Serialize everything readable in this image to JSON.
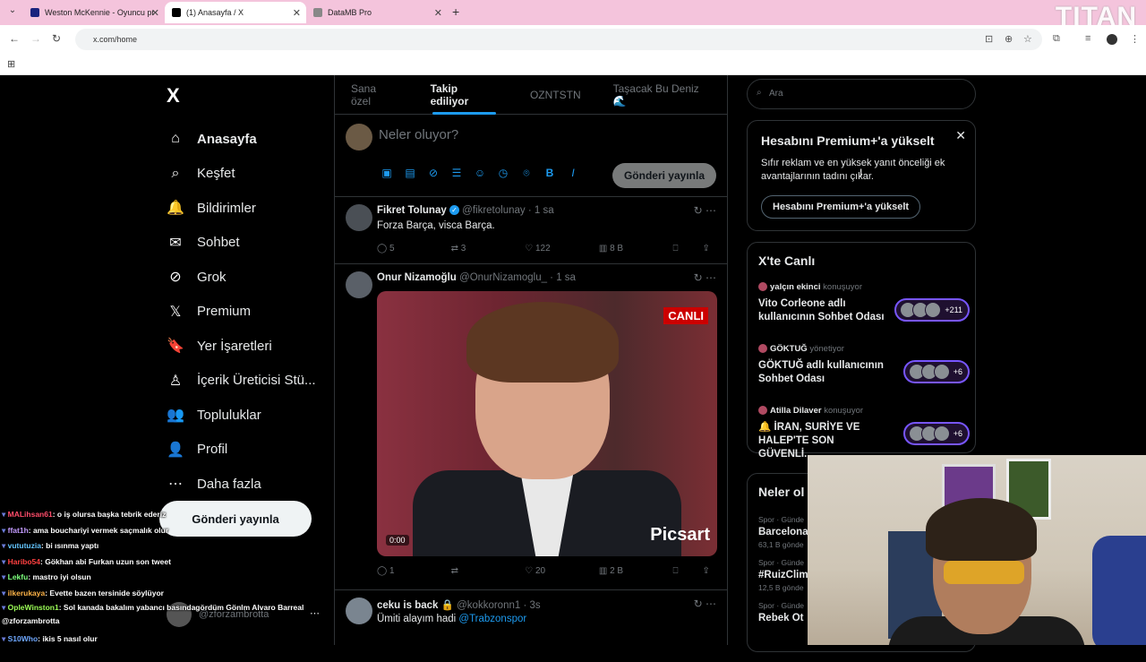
{
  "browser": {
    "tabs": [
      {
        "title": "Weston McKennie - Oyuncu pr",
        "fav_color": "#1a237e",
        "active": false
      },
      {
        "title": "(1) Anasayfa / X",
        "fav_color": "#000000",
        "active": true
      },
      {
        "title": "DataMB Pro",
        "fav_color": "#888888",
        "active": false
      }
    ],
    "url": "x.com/home",
    "watermark": "TITAN"
  },
  "sidebar": {
    "logo": "X",
    "items": [
      {
        "label": "Anasayfa",
        "icon": "⌂",
        "bold": true
      },
      {
        "label": "Keşfet",
        "icon": "⌕"
      },
      {
        "label": "Bildirimler",
        "icon": "🔔"
      },
      {
        "label": "Sohbet",
        "icon": "✉"
      },
      {
        "label": "Grok",
        "icon": "⊘"
      },
      {
        "label": "Premium",
        "icon": "𝕏"
      },
      {
        "label": "Yer İşaretleri",
        "icon": "🔖"
      },
      {
        "label": "İçerik Üreticisi Stü...",
        "icon": "♙"
      },
      {
        "label": "Topluluklar",
        "icon": "👥"
      },
      {
        "label": "Profil",
        "icon": "👤"
      },
      {
        "label": "Daha fazla",
        "icon": "⋯"
      }
    ],
    "post_button": "Gönderi yayınla",
    "account_handle": "@zforzambrotta"
  },
  "timeline": {
    "tabs": [
      "Sana özel",
      "Takip ediliyor",
      "OZNTSTN",
      "Taşacak Bu Deniz🌊"
    ],
    "active_tab": 1,
    "compose_placeholder": "Neler oluyor?",
    "compose_post": "Gönderi yayınla",
    "tweets": [
      {
        "name": "Fikret Tolunay",
        "handle": "@fikretolunay · 1 sa",
        "text": "Forza Barça, visca Barça.",
        "replies": "5",
        "retweets": "3",
        "likes": "122",
        "views": "8 B"
      },
      {
        "name": "Onur Nizamoğlu",
        "handle": "@OnurNizamoglu_ · 1 sa",
        "text": "",
        "replies": "1",
        "retweets": "",
        "likes": "20",
        "views": "2 B",
        "media_badge": "CANLI",
        "media_watermark": "Picsart",
        "media_time": "0:00"
      },
      {
        "name": "ceku is back 🔒",
        "handle": "@kokkoronn1 · 3s",
        "text": "Ümiti alayım hadi ",
        "mention": "@Trabzonspor"
      }
    ]
  },
  "right": {
    "search_placeholder": "Ara",
    "premium": {
      "title": "Hesabını Premium+'a yükselt",
      "desc": "Sıfır reklam ve en yüksek yanıt önceliği ek avantajlarının tadını çıkar.",
      "button": "Hesabını Premium+'a yükselt"
    },
    "live": {
      "title": "X'te Canlı",
      "spaces": [
        {
          "host": "yalçın ekinci",
          "status": "konuşuyor",
          "title": "Vito Corleone adlı kullanıcının Sohbet Odası",
          "count": "+211"
        },
        {
          "host": "GÖKTUĞ",
          "status": "yönetiyor",
          "title": "GÖKTUĞ adlı kullanıcının Sohbet Odası",
          "count": "+6"
        },
        {
          "host": "Atilla Dilaver",
          "status": "konuşuyor",
          "title": "🔔 İRAN, SURİYE VE HALEP'TE SON GÜVENLİ...",
          "count": "+6"
        }
      ]
    },
    "trends": {
      "title": "Neler ol",
      "items": [
        {
          "meta": "Spor · Günde",
          "name": "Barcelona",
          "count": "63,1 B gönde"
        },
        {
          "meta": "Spor · Günde",
          "name": "#RuizClim",
          "count": "12,5 B gönde"
        },
        {
          "meta": "Spor · Günde",
          "name": "Rebek Ot",
          "count": ""
        }
      ]
    }
  },
  "chat": [
    {
      "user": "MALihsan61",
      "color": "#ff4d6a",
      "msg": ": o iş olursa başka tebrik ederiz"
    },
    {
      "user": "ffat1h",
      "color": "#c39bff",
      "msg": ": ama bouchariyi vermek saçmalık olur"
    },
    {
      "user": "vututuzia",
      "color": "#63c5ff",
      "msg": ": bi ısınma yaptı"
    },
    {
      "user": "Haribo54",
      "color": "#ff4040",
      "msg": ": Gökhan abi Furkan uzun son tweet"
    },
    {
      "user": "Lekfu",
      "color": "#7dff7d",
      "msg": ": mastro iyi olsun"
    },
    {
      "user": "ilkerukaya",
      "color": "#ffb347",
      "msg": ": Evette bazen tersinide söylüyor"
    },
    {
      "user": "OpleWinston1",
      "color": "#9cff57",
      "msg": ": Sol kanada bakalım yabancı basındagördüm Gönlm Alvaro Barreal @zforzambrotta"
    },
    {
      "user": "S10Who",
      "color": "#6fa8ff",
      "msg": ": ikis 5 nasıl olur"
    }
  ]
}
